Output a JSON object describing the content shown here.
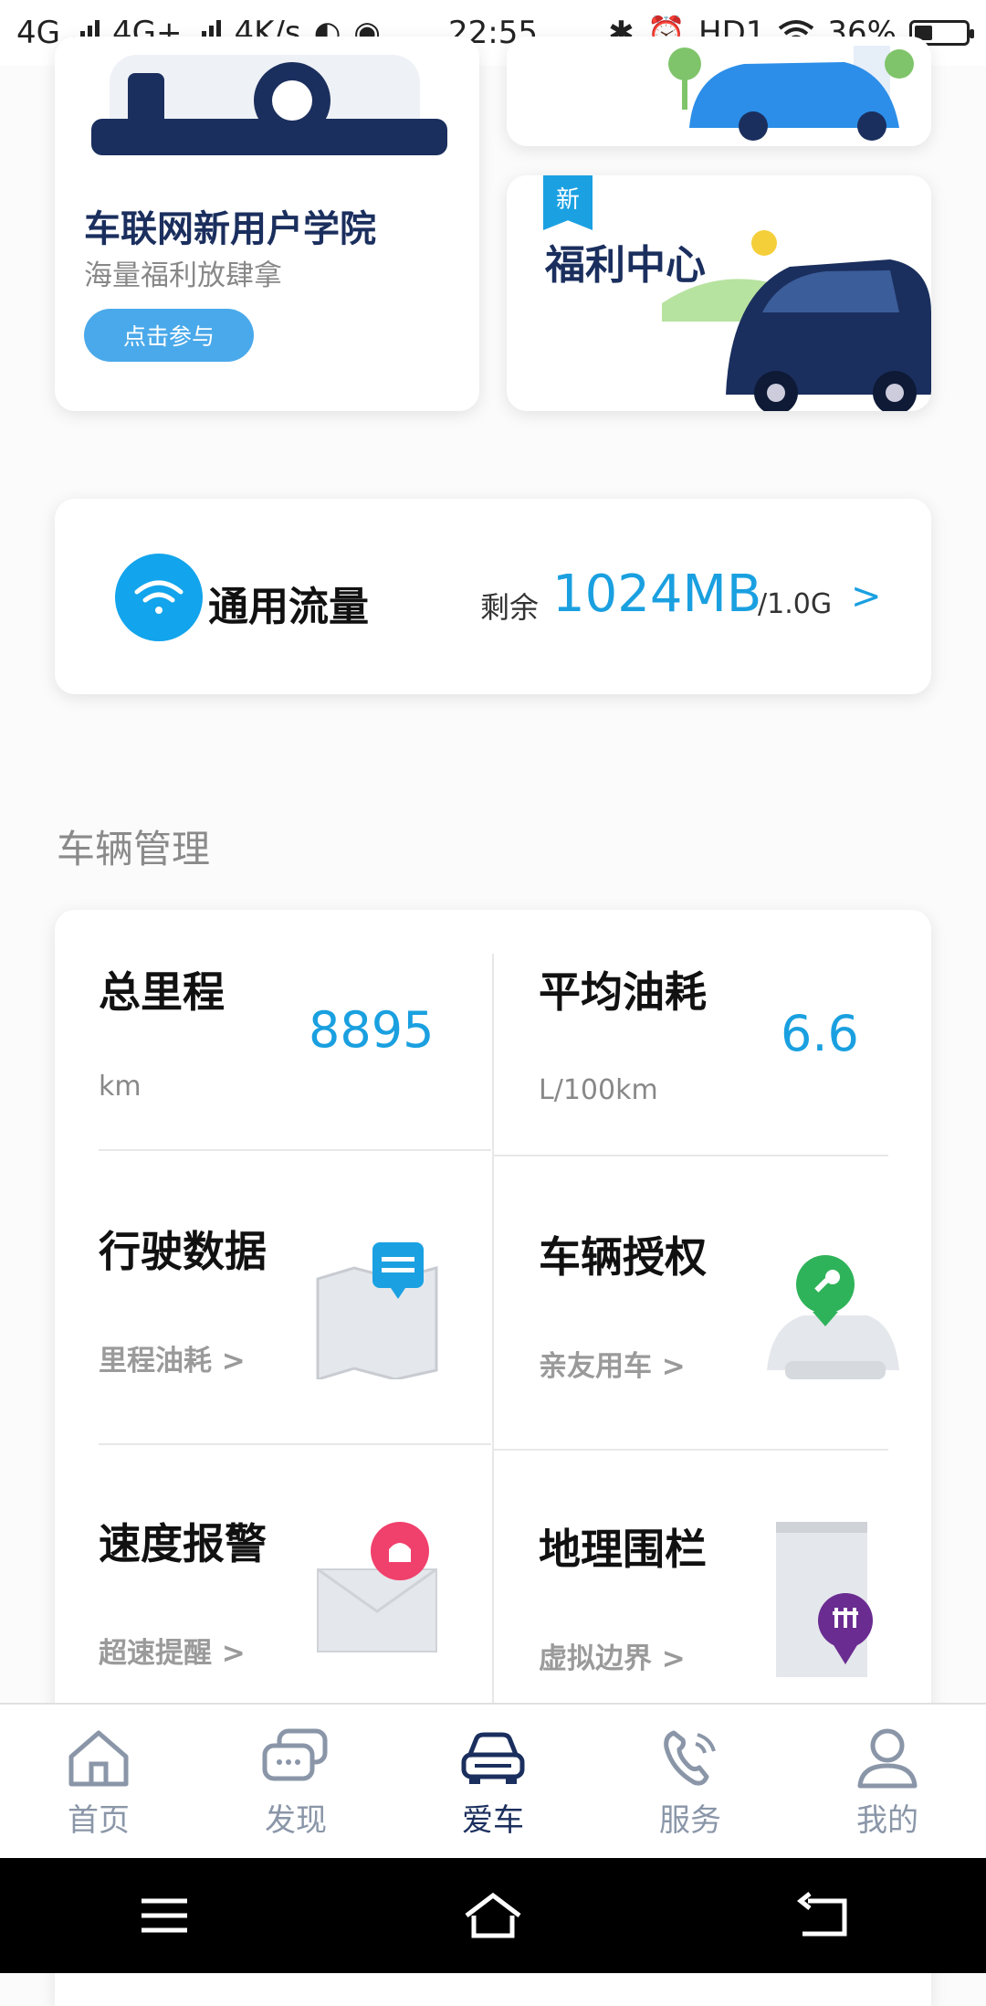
{
  "status_bar": {
    "left_text_1": "4G",
    "left_text_2": "4G+",
    "net_speed": "4K/s",
    "time": "22:55",
    "hd": "HD1",
    "battery_percent": "36%",
    "battery_level": 0.36
  },
  "promo_left": {
    "title": "车联网新用户学院",
    "subtitle": "海量福利放肆拿",
    "button": "点击参与"
  },
  "promo_right": {
    "badge": "新",
    "title": "福利中心"
  },
  "data_usage": {
    "label": "通用流量",
    "remain_label": "剩余",
    "remain_value": "1024MB",
    "total": "/1.0G",
    "chevron": ">"
  },
  "section": {
    "title": "车辆管理"
  },
  "stats": {
    "mileage_title": "总里程",
    "mileage_value": "8895",
    "mileage_unit": "km",
    "fuel_title": "平均油耗",
    "fuel_value": "6.6",
    "fuel_unit": "L/100km"
  },
  "tiles": {
    "driving": {
      "title": "行驶数据",
      "sub": "里程油耗 >"
    },
    "auth": {
      "title": "车辆授权",
      "sub": "亲友用车 >"
    },
    "speed": {
      "title": "速度报警",
      "sub": "超速提醒 >"
    },
    "geo": {
      "title": "地理围栏",
      "sub": "虚拟边界 >"
    }
  },
  "tabbar": {
    "home": "首页",
    "discover": "发现",
    "car": "爱车",
    "service": "服务",
    "mine": "我的"
  },
  "colors": {
    "accent": "#1aa0e0",
    "navy": "#1b2f5e",
    "muted": "#8a96a8"
  }
}
